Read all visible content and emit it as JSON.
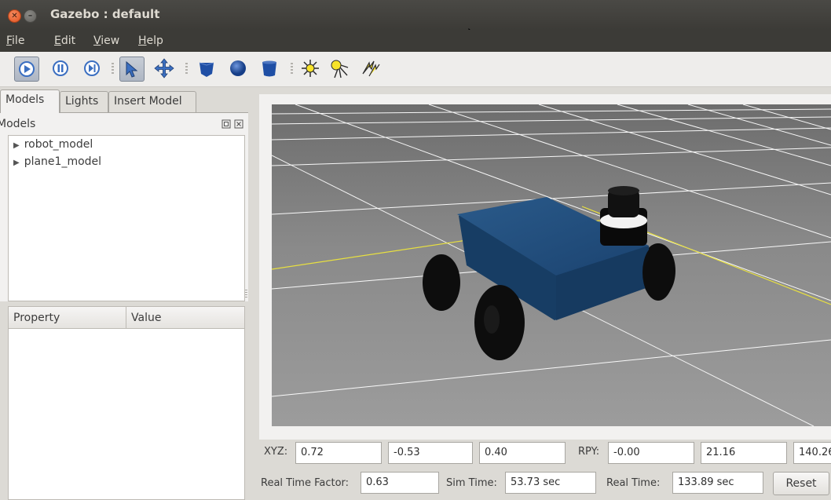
{
  "window": {
    "title": "Gazebo : default"
  },
  "menu": [
    {
      "label": "File",
      "underline": "F",
      "rest": "ile"
    },
    {
      "label": "Edit",
      "underline": "E",
      "rest": "dit"
    },
    {
      "label": "View",
      "underline": "V",
      "rest": "iew"
    },
    {
      "label": "Help",
      "underline": "H",
      "rest": "elp"
    }
  ],
  "toolbar": {
    "tools": [
      "play-icon",
      "pause-icon",
      "step-icon",
      "select-arrow-icon",
      "translate-icon",
      "box-shape-icon",
      "sphere-shape-icon",
      "cylinder-shape-icon",
      "point-light-icon",
      "spot-light-icon",
      "directional-light-icon"
    ]
  },
  "left_panel": {
    "tabs": [
      "Models",
      "Lights",
      "Insert Model"
    ],
    "models_header": "Models",
    "models": [
      "robot_model",
      "plane1_model"
    ],
    "property_headers": [
      "Property",
      "Value"
    ]
  },
  "pose": {
    "xyz_label": "XYZ:",
    "x": "0.72",
    "y": "-0.53",
    "z": "0.40",
    "rpy_label": "RPY:",
    "roll": "-0.00",
    "pitch": "21.16",
    "yaw": "140.26"
  },
  "time": {
    "rtf_label": "Real Time Factor:",
    "rtf": "0.63",
    "sim_label": "Sim Time:",
    "sim": "53.73 sec",
    "real_label": "Real Time:",
    "real": "133.89 sec",
    "reset_label": "Reset"
  },
  "colors": {
    "titlebar": "#3c3b37",
    "ground": "#8f8f8f",
    "robot_body": "#1f4c78",
    "wheel": "#0f0f0f",
    "axis_line": "#e8e040"
  }
}
